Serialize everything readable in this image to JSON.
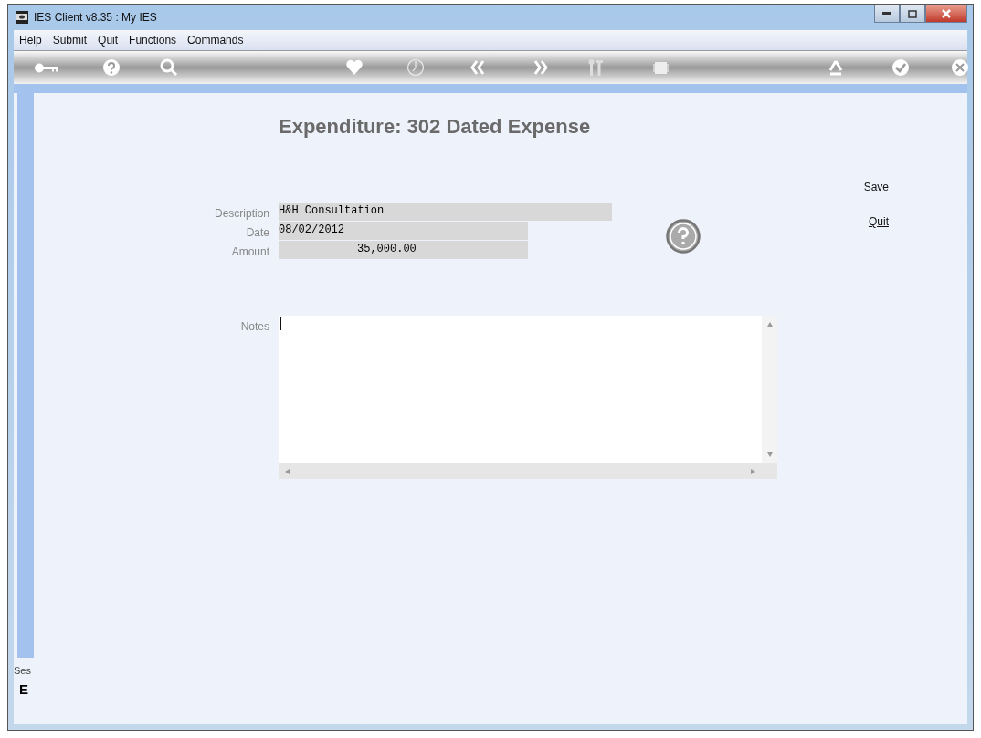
{
  "window": {
    "title": "IES Client v8.35 : My IES"
  },
  "menu": [
    "Help",
    "Submit",
    "Quit",
    "Functions",
    "Commands"
  ],
  "heading": "Expenditure: 302 Dated Expense",
  "fields": [
    {
      "label": "Description",
      "value": "H&H Consultation",
      "kind": "long"
    },
    {
      "label": "Date",
      "value": "08/02/2012",
      "kind": "short"
    },
    {
      "label": "Amount",
      "value": "35,000.00",
      "kind": "amount"
    }
  ],
  "links": [
    "Save",
    "Quit"
  ],
  "notes": {
    "label": "Notes"
  },
  "side_panel": {
    "label": "Ses",
    "glyph": "E"
  }
}
